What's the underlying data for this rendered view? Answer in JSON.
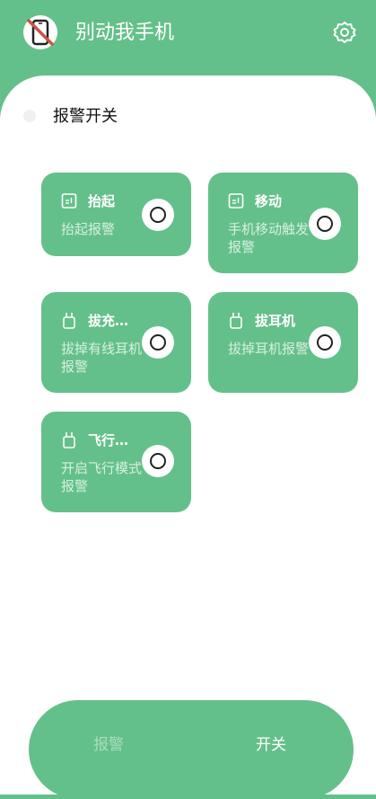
{
  "header": {
    "title": "别动我手机"
  },
  "alarm_switch": {
    "label": "报警开关"
  },
  "cards": [
    {
      "title": "抬起",
      "desc": "抬起报警"
    },
    {
      "title": "移动",
      "desc": "手机移动触发报警"
    },
    {
      "title": "拔充…",
      "desc": "拔掉有线耳机报警"
    },
    {
      "title": "拔耳机",
      "desc": "拔掉耳机报警"
    },
    {
      "title": "飞行…",
      "desc": "开启飞行模式报警"
    }
  ],
  "bottom_nav": {
    "alarm_label": "报警",
    "switch_label": "开关"
  },
  "icons": {
    "app": "phone-crossed-icon",
    "settings": "gear-icon",
    "sensor": "sensor-icon",
    "plug": "plug-icon"
  },
  "colors": {
    "accent": "#64c08a",
    "background": "#ffffff",
    "icon_red": "#c8534a"
  }
}
